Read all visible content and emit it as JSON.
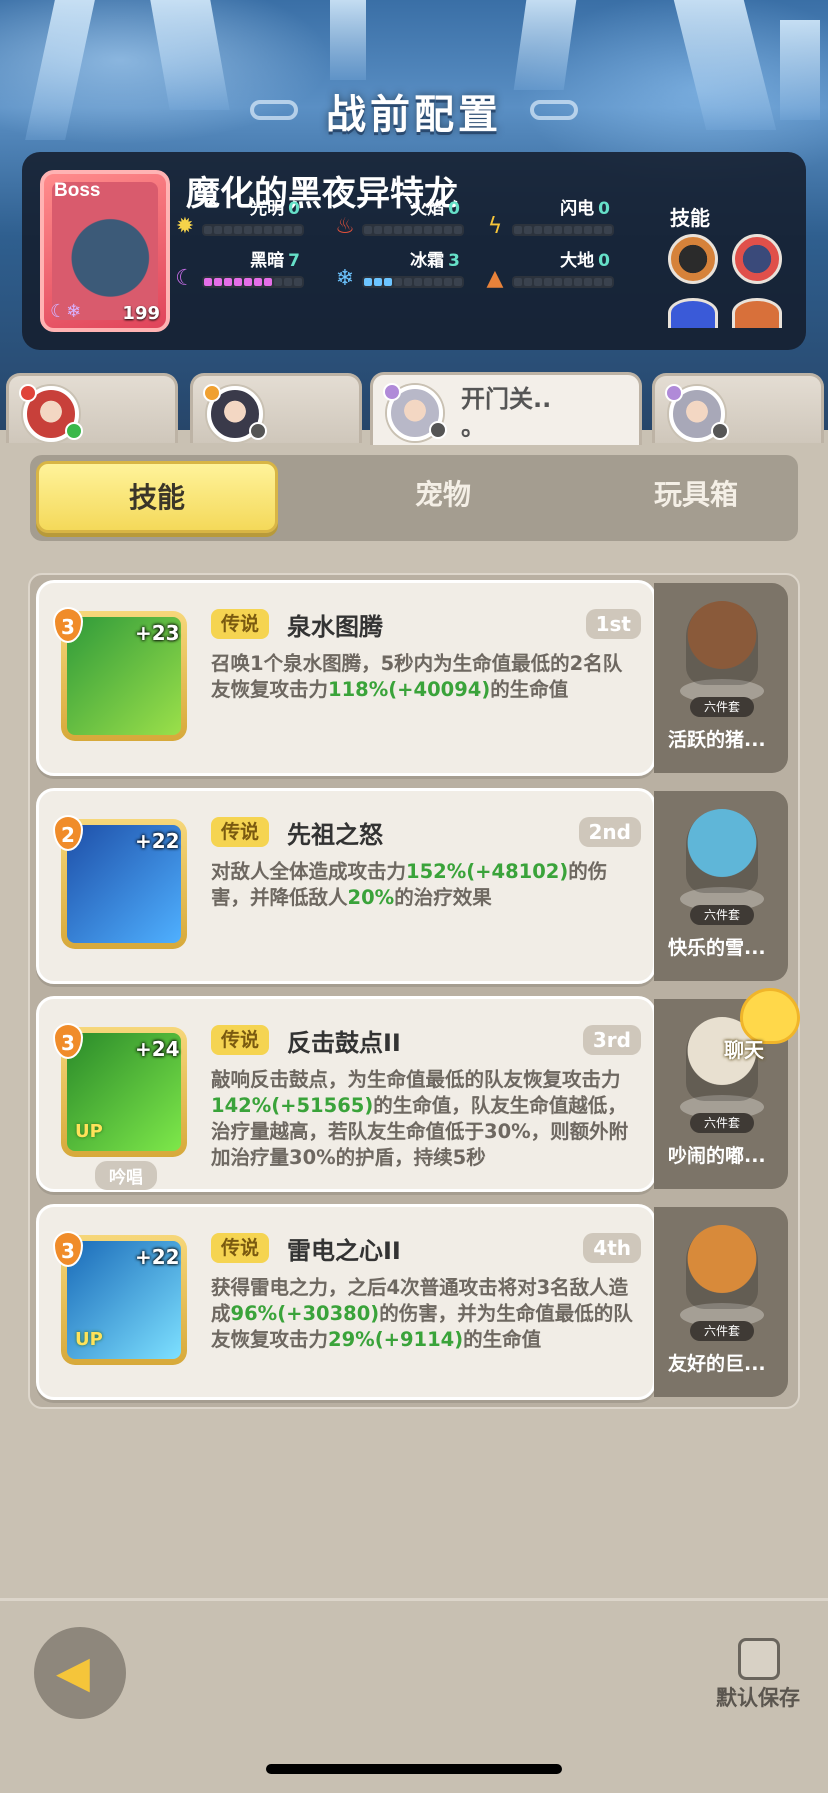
{
  "title": "战前配置",
  "boss": {
    "tag": "Boss",
    "level": "199",
    "name": "魔化的黑夜异特龙",
    "skills_label": "技能",
    "elements": [
      {
        "key": "light",
        "label": "光明",
        "value": "0",
        "icon": "sun-icon",
        "color": "#f6d34a",
        "filled": 0,
        "fill": ""
      },
      {
        "key": "fire",
        "label": "火焰",
        "value": "0",
        "icon": "flame-icon",
        "color": "#e0503a",
        "filled": 0,
        "fill": ""
      },
      {
        "key": "thunder",
        "label": "闪电",
        "value": "0",
        "icon": "lightning-icon",
        "color": "#f6c53a",
        "filled": 0,
        "fill": ""
      },
      {
        "key": "dark",
        "label": "黑暗",
        "value": "7",
        "icon": "moon-icon",
        "color": "#c86ee8",
        "filled": 7,
        "fill": "on-dark"
      },
      {
        "key": "frost",
        "label": "冰霜",
        "value": "3",
        "icon": "snowflake-icon",
        "color": "#6cc4ff",
        "filled": 3,
        "fill": "on-ice"
      },
      {
        "key": "earth",
        "label": "大地",
        "value": "0",
        "icon": "mountain-icon",
        "color": "#e8823a",
        "filled": 0,
        "fill": ""
      }
    ]
  },
  "heroes": [
    {
      "name": ""
    },
    {
      "name": ""
    },
    {
      "name": "开门关..\n。"
    },
    {
      "name": ""
    }
  ],
  "tabs": [
    "技能",
    "宠物",
    "玩具箱"
  ],
  "skills": [
    {
      "level": "3",
      "plus": "+23",
      "rarity": "传说",
      "name": "泉水图腾",
      "order": "1st",
      "desc": [
        {
          "t": "召唤1个泉水图腾，5秒内为生命值最低的2名队友恢复攻击力",
          "g": false
        },
        {
          "t": "118%(+40094)",
          "g": true
        },
        {
          "t": "的生命值",
          "g": false
        }
      ],
      "icon_colors": [
        "#2f9a3a",
        "#9be04a"
      ],
      "up": "",
      "chant": "",
      "toy": {
        "name": "活跃的猪...",
        "set": "六件套",
        "color": "#8a5a3a"
      }
    },
    {
      "level": "2",
      "plus": "+22",
      "rarity": "传说",
      "name": "先祖之怒",
      "order": "2nd",
      "desc": [
        {
          "t": "对敌人全体造成攻击力",
          "g": false
        },
        {
          "t": "152%(+48102)",
          "g": true
        },
        {
          "t": "的伤害，并降低敌人",
          "g": false
        },
        {
          "t": "20%",
          "g": true
        },
        {
          "t": "的治疗效果",
          "g": false
        }
      ],
      "icon_colors": [
        "#1e4fa8",
        "#4fb0ff"
      ],
      "up": "",
      "chant": "",
      "toy": {
        "name": "快乐的雪...",
        "set": "六件套",
        "color": "#5fb6d8"
      }
    },
    {
      "level": "3",
      "plus": "+24",
      "rarity": "传说",
      "name": "反击鼓点II",
      "order": "3rd",
      "desc": [
        {
          "t": "敲响反击鼓点，为生命值最低的队友恢复攻击力",
          "g": false
        },
        {
          "t": "142%(+51565)",
          "g": true
        },
        {
          "t": "的生命值，队友生命值越低，治疗量越高，若队友生命值低于30%，则额外附加治疗量30%的护盾，持续5秒",
          "g": false
        }
      ],
      "icon_colors": [
        "#2a8a2a",
        "#7ee84a"
      ],
      "up": "UP",
      "chant": "吟唱",
      "toy": {
        "name": "吵闹的嘟...",
        "set": "六件套",
        "color": "#e8e0d0"
      }
    },
    {
      "level": "3",
      "plus": "+22",
      "rarity": "传说",
      "name": "雷电之心II",
      "order": "4th",
      "desc": [
        {
          "t": "获得雷电之力，之后4次普通攻击将对3名敌人造成",
          "g": false
        },
        {
          "t": "96%(+30380)",
          "g": true
        },
        {
          "t": "的伤害，并为生命值最低的队友恢复攻击力",
          "g": false
        },
        {
          "t": "29%(+9114)",
          "g": true
        },
        {
          "t": "的生命值",
          "g": false
        }
      ],
      "icon_colors": [
        "#1a6ab8",
        "#7de0ff"
      ],
      "up": "UP",
      "chant": "",
      "toy": {
        "name": "友好的巨...",
        "set": "六件套",
        "color": "#d88a3a"
      }
    }
  ],
  "chat_label": "聊天",
  "footer": {
    "save_label": "默认保存"
  }
}
